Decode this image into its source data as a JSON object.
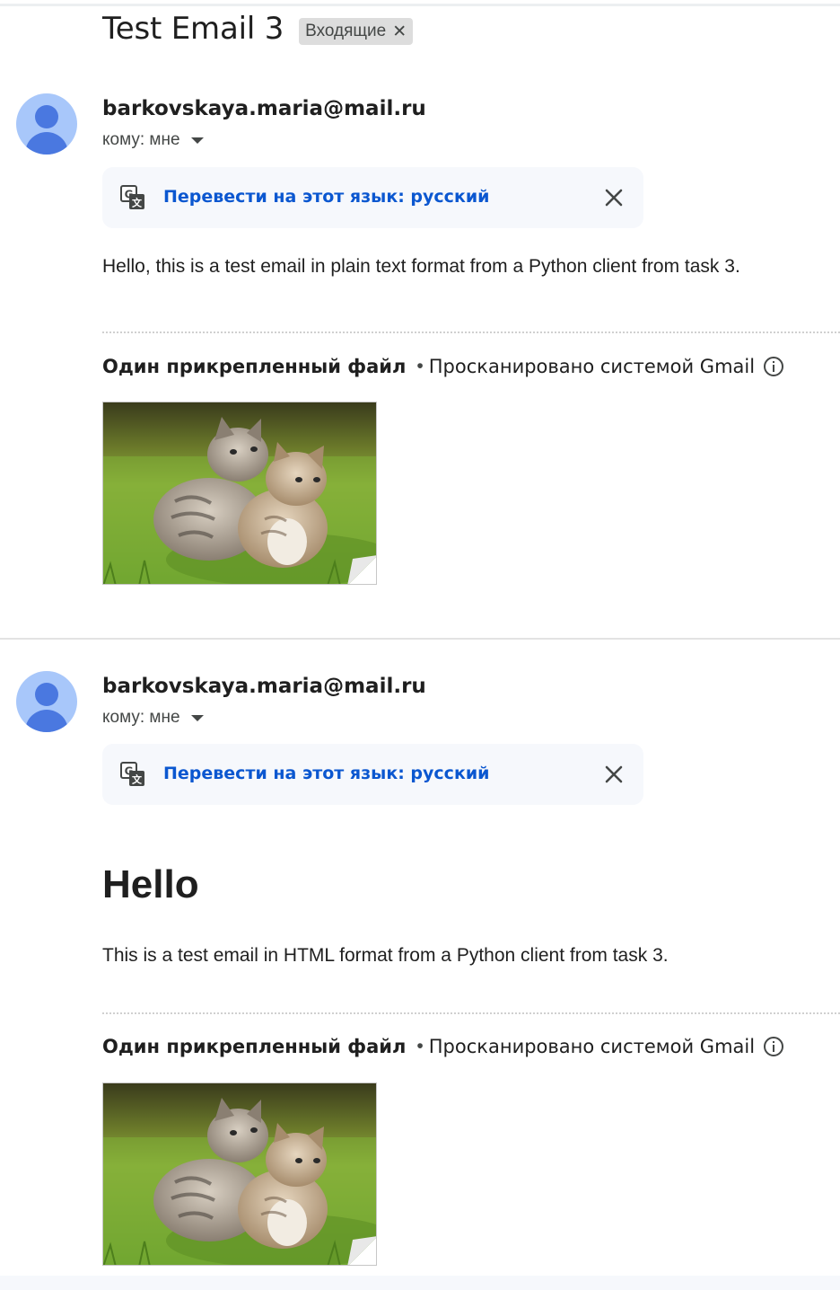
{
  "email": {
    "subject": "Test Email 3",
    "label": "Входящие"
  },
  "icons": {
    "translate": "translate-icon",
    "close": "close-icon",
    "info": "info-icon",
    "avatar": "avatar-icon",
    "caret": "chevron-down-icon"
  },
  "colors": {
    "link": "#0b57d0",
    "avatar_bg": "#a8c7fa",
    "avatar_fg": "#4a78e0",
    "translate_bar_bg": "#f6f8fc"
  },
  "messages": [
    {
      "sender": "barkovskaya.maria@mail.ru",
      "recipient": "кому: мне",
      "translate_label": "Перевести на этот язык: русский",
      "body": "Hello, this is a test email in plain text format from a Python client from task 3.",
      "attachments_title": "Один прикрепленный файл",
      "attachments_separator": "•",
      "attachments_scan": "Просканировано системой Gmail"
    },
    {
      "sender": "barkovskaya.maria@mail.ru",
      "recipient": "кому: мне",
      "translate_label": "Перевести на этот язык: русский",
      "heading": "Hello",
      "body": "This is a test email in HTML format from a Python client from task 3.",
      "attachments_title": "Один прикрепленный файл",
      "attachments_separator": "•",
      "attachments_scan": "Просканировано системой Gmail"
    }
  ]
}
